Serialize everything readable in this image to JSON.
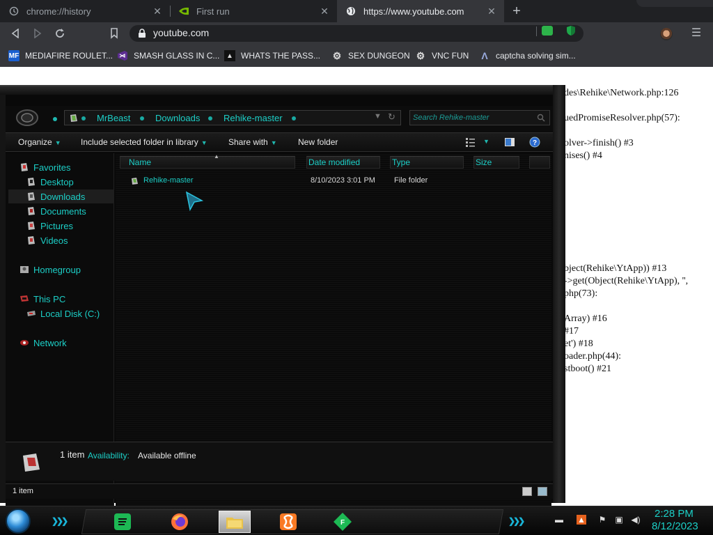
{
  "browser": {
    "tabs": [
      {
        "title": "chrome://history",
        "icon": "history-icon"
      },
      {
        "title": "First run",
        "icon": "nvidia-icon"
      },
      {
        "title": "https://www.youtube.com",
        "icon": "globe-icon"
      }
    ],
    "omnibox": {
      "url": "youtube.com"
    },
    "bookmarks": [
      {
        "label": "MEDIAFIRE ROULET...",
        "icon": "mediafire-icon"
      },
      {
        "label": "SMASH GLASS IN C...",
        "icon": "visual-studio-icon"
      },
      {
        "label": "WHATS THE PASS...",
        "icon": "dark-page-icon"
      },
      {
        "label": "SEX DUNGEON",
        "icon": "gear-icon"
      },
      {
        "label": "VNC FUN",
        "icon": "gear-icon"
      },
      {
        "label": "captcha solving sim...",
        "icon": "lambda-icon"
      }
    ]
  },
  "page": {
    "error_lines": [
      "des\\Rehike\\Network.php:126",
      "uedPromiseResolver.php(57):",
      "olver->finish() #3",
      "nises() #4",
      "bject(Rehike\\YtApp)) #13",
      "->get(Object(Rehike\\YtApp), '',",
      "php(73):",
      "Array) #16",
      "#17",
      "et') #18",
      "oader.php(44):",
      "stboot() #21"
    ]
  },
  "explorer": {
    "breadcrumbs": [
      "MrBeast",
      "Downloads",
      "Rehike-master"
    ],
    "search_placeholder": "Search Rehike-master",
    "commands": {
      "organize": "Organize",
      "include": "Include selected folder in library",
      "share": "Share with",
      "newfolder": "New folder"
    },
    "nav": {
      "favorites": "Favorites",
      "desktop": "Desktop",
      "downloads": "Downloads",
      "documents": "Documents",
      "pictures": "Pictures",
      "videos": "Videos",
      "homegroup": "Homegroup",
      "thispc": "This PC",
      "localdisk": "Local Disk (C:)",
      "network": "Network"
    },
    "columns": {
      "name": "Name",
      "date": "Date modified",
      "type": "Type",
      "size": "Size"
    },
    "files": [
      {
        "name": "Rehike-master",
        "date": "8/10/2023 3:01 PM",
        "type": "File folder",
        "size": ""
      }
    ],
    "details": {
      "count": "1 item",
      "availability_label": "Availability:",
      "availability_value": "Available offline"
    },
    "status": {
      "count": "1 item"
    }
  },
  "taskbar": {
    "time": "2:28 PM",
    "date": "8/12/2023",
    "apps": [
      "spotify-icon",
      "firefox-icon",
      "file-explorer-icon",
      "xampp-icon",
      "f-app-icon"
    ]
  },
  "colors": {
    "accent": "#1ccfc7",
    "explorer_bg": "#090909",
    "chrome_toolbar": "#35363a"
  }
}
